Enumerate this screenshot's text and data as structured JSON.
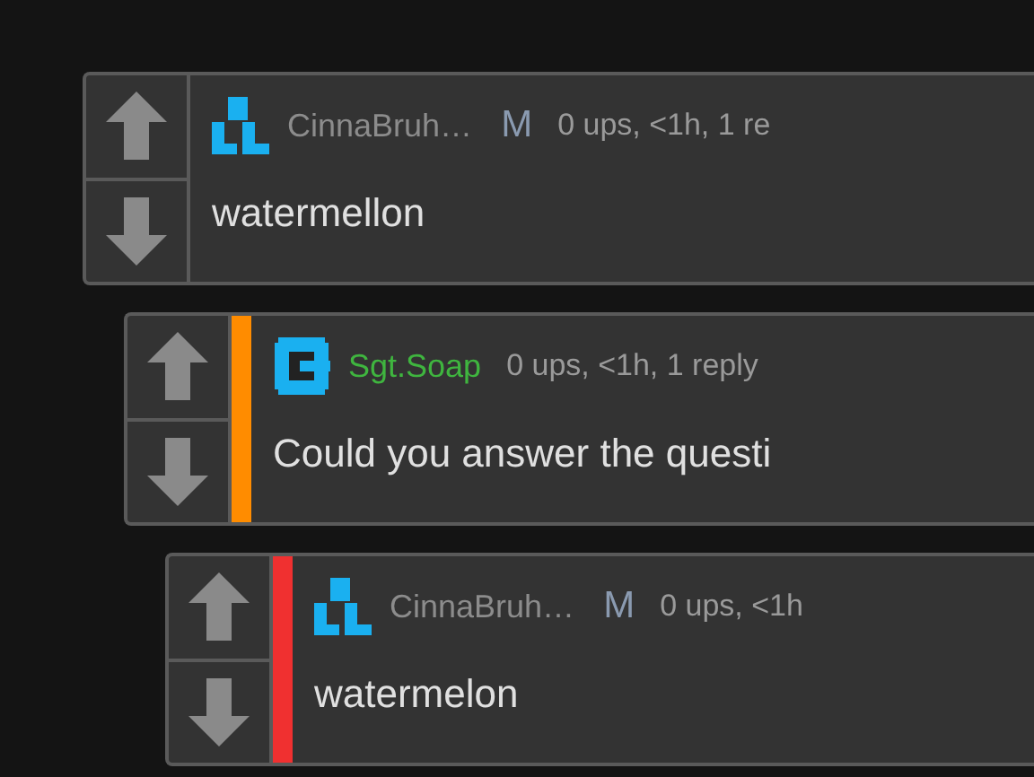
{
  "comments": [
    {
      "kind": "steps",
      "user": {
        "name": "CinnaBruh…",
        "color": "#8c8c8c"
      },
      "badge": "M",
      "meta": "0 ups, <1h, 1 re",
      "text": "watermellon",
      "children": [
        {
          "kind": "bracket",
          "user": {
            "name": "Sgt.Soap",
            "color": "#3fb53f"
          },
          "color": "#ff8c00",
          "meta": "0 ups, <1h, 1 reply",
          "text": "Could you answer the questi",
          "children": [
            {
              "kind": "steps",
              "user": {
                "name": "CinnaBruh…",
                "color": "#8c8c8c"
              },
              "badge": "M",
              "color": "#f03030",
              "meta": "0 ups, <1h",
              "text": "watermelon"
            }
          ]
        }
      ]
    }
  ]
}
